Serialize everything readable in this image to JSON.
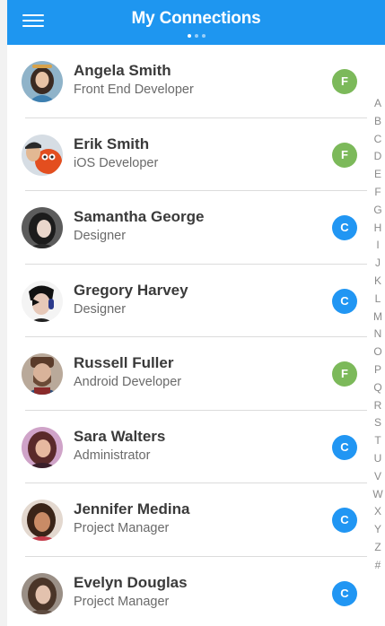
{
  "header": {
    "title": "My Connections",
    "page_dots": 3,
    "active_dot": 0,
    "menu_icon": "hamburger-menu-icon",
    "color": "#1e96f0"
  },
  "contacts": [
    {
      "name": "Angela Smith",
      "role": "Front End Developer",
      "badge": "F",
      "badge_color": "#7cb95a"
    },
    {
      "name": "Erik Smith",
      "role": "iOS Developer",
      "badge": "F",
      "badge_color": "#7cb95a"
    },
    {
      "name": "Samantha George",
      "role": "Designer",
      "badge": "C",
      "badge_color": "#2196f3"
    },
    {
      "name": "Gregory Harvey",
      "role": "Designer",
      "badge": "C",
      "badge_color": "#2196f3"
    },
    {
      "name": "Russell Fuller",
      "role": "Android Developer",
      "badge": "F",
      "badge_color": "#7cb95a"
    },
    {
      "name": "Sara Walters",
      "role": "Administrator",
      "badge": "C",
      "badge_color": "#2196f3"
    },
    {
      "name": "Jennifer Medina",
      "role": "Project Manager",
      "badge": "C",
      "badge_color": "#2196f3"
    },
    {
      "name": "Evelyn Douglas",
      "role": "Project Manager",
      "badge": "C",
      "badge_color": "#2196f3"
    }
  ],
  "alphabet_index": [
    "A",
    "B",
    "C",
    "D",
    "E",
    "F",
    "G",
    "H",
    "I",
    "J",
    "K",
    "L",
    "M",
    "N",
    "O",
    "P",
    "Q",
    "R",
    "S",
    "T",
    "U",
    "V",
    "W",
    "X",
    "Y",
    "Z",
    "#"
  ]
}
